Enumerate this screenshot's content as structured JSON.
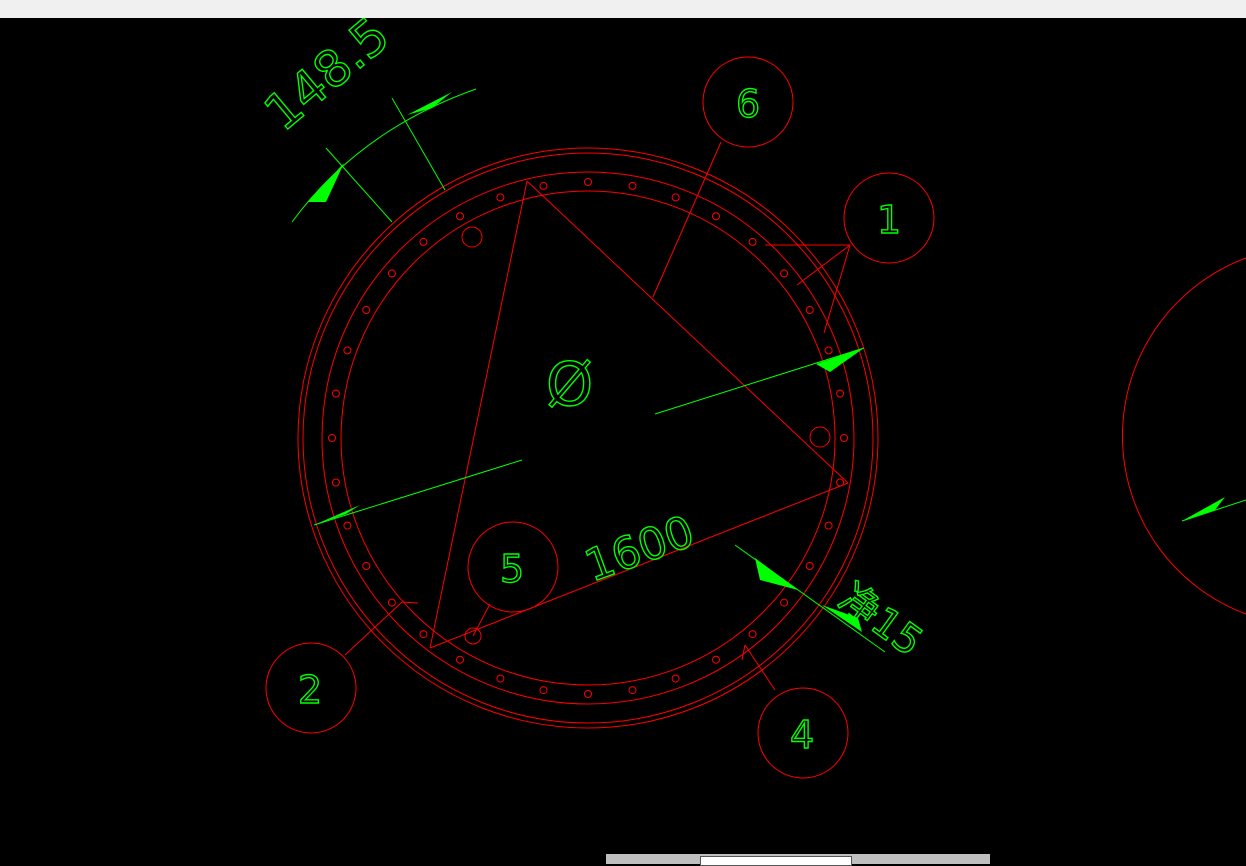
{
  "window": {
    "top_bar_color": "#f0f0f0"
  },
  "drawing": {
    "background": "#000000",
    "line_color": "#ff0000",
    "dim_color": "#00ff00",
    "dim_angle_text": "148.5",
    "dim_diameter_text": "1600",
    "diameter_symbol": "Ø",
    "dim_clear_text": "净15",
    "callouts": [
      "6",
      "1",
      "5",
      "2",
      "4"
    ]
  },
  "statusbar": {
    "visible": true
  }
}
